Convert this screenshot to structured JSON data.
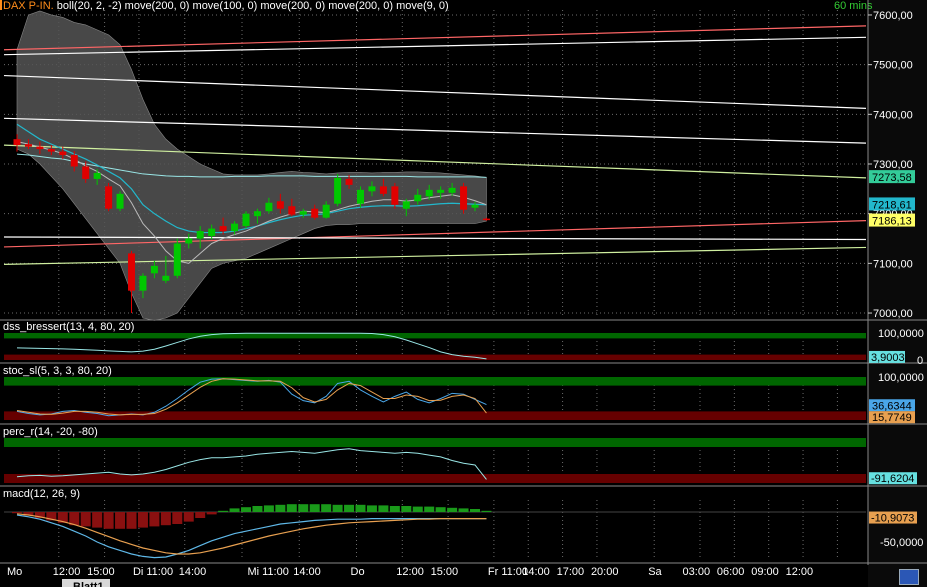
{
  "colors": {
    "background": "#000000",
    "grid": "#6c6c6c",
    "bull": "#00c800",
    "bear": "#e00000",
    "boll_fill": "#555555",
    "ma_cyan": "#22b8cc",
    "ma_lightcyan": "#99e6e6",
    "band_green": "#006600",
    "band_red": "#660000",
    "panel_bg": "#000000",
    "axis_panel": "#000000"
  },
  "header": {
    "symbol": "DAX P-IN.",
    "indicators": "boll(20, 2, -2) move(200, 0) move(100, 0) move(200, 0) move(200, 0) move(9, 0)",
    "interval": "60 mins"
  },
  "tabs": {
    "active": "Blatt1"
  },
  "chart_data": [
    {
      "type": "candlestick",
      "panel": "price",
      "ylim": [
        6990,
        7610
      ],
      "y_ticks": [
        "7600,00",
        "7500,00",
        "7400,00",
        "7300,00",
        "7200,00",
        "7100,00",
        "7000,00"
      ],
      "y_tick_values": [
        7600,
        7500,
        7400,
        7300,
        7200,
        7100,
        7000
      ],
      "price_labels": [
        {
          "text": "7273,58",
          "value": 7273.58,
          "color": "#33cc99"
        },
        {
          "text": "7218,61",
          "value": 7218.61,
          "color": "#22b8cc"
        },
        {
          "text": "7186,13",
          "value": 7186.13,
          "color": "#ffff66"
        }
      ],
      "candles": [
        {
          "o": 7350,
          "h": 7360,
          "l": 7325,
          "c": 7338
        },
        {
          "o": 7340,
          "h": 7350,
          "l": 7330,
          "c": 7335
        },
        {
          "o": 7335,
          "h": 7345,
          "l": 7320,
          "c": 7330
        },
        {
          "o": 7330,
          "h": 7338,
          "l": 7318,
          "c": 7325
        },
        {
          "o": 7325,
          "h": 7335,
          "l": 7310,
          "c": 7318
        },
        {
          "o": 7318,
          "h": 7326,
          "l": 7285,
          "c": 7295
        },
        {
          "o": 7295,
          "h": 7305,
          "l": 7262,
          "c": 7270
        },
        {
          "o": 7270,
          "h": 7290,
          "l": 7258,
          "c": 7282
        },
        {
          "o": 7255,
          "h": 7262,
          "l": 7205,
          "c": 7210
        },
        {
          "o": 7210,
          "h": 7245,
          "l": 7205,
          "c": 7240
        },
        {
          "o": 7120,
          "h": 7125,
          "l": 7000,
          "c": 7045
        },
        {
          "o": 7045,
          "h": 7080,
          "l": 7030,
          "c": 7075
        },
        {
          "o": 7080,
          "h": 7105,
          "l": 7070,
          "c": 7095
        },
        {
          "o": 7065,
          "h": 7115,
          "l": 7060,
          "c": 7075
        },
        {
          "o": 7075,
          "h": 7150,
          "l": 7070,
          "c": 7140
        },
        {
          "o": 7140,
          "h": 7160,
          "l": 7130,
          "c": 7150
        },
        {
          "o": 7150,
          "h": 7175,
          "l": 7130,
          "c": 7165
        },
        {
          "o": 7155,
          "h": 7178,
          "l": 7148,
          "c": 7170
        },
        {
          "o": 7175,
          "h": 7192,
          "l": 7158,
          "c": 7165
        },
        {
          "o": 7165,
          "h": 7185,
          "l": 7158,
          "c": 7180
        },
        {
          "o": 7175,
          "h": 7205,
          "l": 7170,
          "c": 7200
        },
        {
          "o": 7195,
          "h": 7210,
          "l": 7180,
          "c": 7205
        },
        {
          "o": 7205,
          "h": 7232,
          "l": 7200,
          "c": 7222
        },
        {
          "o": 7225,
          "h": 7240,
          "l": 7200,
          "c": 7210
        },
        {
          "o": 7215,
          "h": 7230,
          "l": 7195,
          "c": 7198
        },
        {
          "o": 7198,
          "h": 7210,
          "l": 7192,
          "c": 7205
        },
        {
          "o": 7210,
          "h": 7218,
          "l": 7188,
          "c": 7192
        },
        {
          "o": 7192,
          "h": 7225,
          "l": 7190,
          "c": 7218
        },
        {
          "o": 7220,
          "h": 7280,
          "l": 7215,
          "c": 7272
        },
        {
          "o": 7270,
          "h": 7278,
          "l": 7250,
          "c": 7258
        },
        {
          "o": 7220,
          "h": 7255,
          "l": 7212,
          "c": 7248
        },
        {
          "o": 7245,
          "h": 7265,
          "l": 7235,
          "c": 7255
        },
        {
          "o": 7255,
          "h": 7270,
          "l": 7235,
          "c": 7240
        },
        {
          "o": 7255,
          "h": 7262,
          "l": 7210,
          "c": 7218
        },
        {
          "o": 7210,
          "h": 7230,
          "l": 7195,
          "c": 7225
        },
        {
          "o": 7225,
          "h": 7250,
          "l": 7218,
          "c": 7238
        },
        {
          "o": 7235,
          "h": 7258,
          "l": 7228,
          "c": 7248
        },
        {
          "o": 7242,
          "h": 7255,
          "l": 7230,
          "c": 7248
        },
        {
          "o": 7242,
          "h": 7262,
          "l": 7236,
          "c": 7252
        },
        {
          "o": 7255,
          "h": 7262,
          "l": 7200,
          "c": 7208
        },
        {
          "o": 7212,
          "h": 7224,
          "l": 7205,
          "c": 7218
        },
        {
          "o": 7190,
          "h": 7192,
          "l": 7186,
          "c": 7188
        }
      ],
      "boll_upper": [
        7530,
        7600,
        7608,
        7600,
        7595,
        7585,
        7580,
        7570,
        7560,
        7540,
        7490,
        7430,
        7380,
        7350,
        7330,
        7315,
        7300,
        7290,
        7280,
        7278,
        7278,
        7278,
        7280,
        7283,
        7285,
        7283,
        7282,
        7280,
        7282,
        7283,
        7283,
        7282,
        7283,
        7283,
        7284,
        7284,
        7283,
        7282,
        7280,
        7278,
        7276,
        7273
      ],
      "boll_lower": [
        7330,
        7320,
        7300,
        7275,
        7250,
        7220,
        7190,
        7160,
        7130,
        7100,
        7040,
        6990,
        6985,
        6990,
        7000,
        7030,
        7060,
        7090,
        7100,
        7105,
        7110,
        7120,
        7130,
        7140,
        7150,
        7160,
        7170,
        7176,
        7178,
        7178,
        7180,
        7180,
        7180,
        7180,
        7180,
        7180,
        7180,
        7180,
        7180,
        7180,
        7180,
        7185
      ],
      "ma9": [
        7345,
        7340,
        7334,
        7328,
        7321,
        7310,
        7296,
        7285,
        7270,
        7256,
        7222,
        7180,
        7155,
        7125,
        7105,
        7100,
        7120,
        7140,
        7150,
        7158,
        7165,
        7175,
        7185,
        7193,
        7200,
        7205,
        7204,
        7202,
        7208,
        7215,
        7220,
        7225,
        7228,
        7228,
        7225,
        7228,
        7232,
        7235,
        7238,
        7233,
        7226,
        7218
      ],
      "ma_cyan": [
        7380,
        7365,
        7350,
        7340,
        7330,
        7320,
        7310,
        7298,
        7285,
        7272,
        7250,
        7218,
        7200,
        7185,
        7172,
        7165,
        7162,
        7162,
        7162,
        7165,
        7170,
        7175,
        7182,
        7188,
        7193,
        7197,
        7198,
        7200,
        7205,
        7210,
        7213,
        7215,
        7216,
        7216,
        7215,
        7216,
        7218,
        7220,
        7221,
        7220,
        7219,
        7218
      ],
      "ma_lightcyan": [
        7320,
        7318,
        7315,
        7312,
        7310,
        7305,
        7300,
        7296,
        7292,
        7288,
        7284,
        7280,
        7278,
        7276,
        7275,
        7275,
        7274,
        7274,
        7274,
        7275,
        7275,
        7275,
        7276,
        7276,
        7276,
        7276,
        7275,
        7275,
        7275,
        7275,
        7275,
        7275,
        7275,
        7275,
        7275,
        7274,
        7274,
        7274,
        7274,
        7274,
        7274,
        7273
      ],
      "trend_lines": [
        {
          "color": "#ff6666",
          "y_start": 7530,
          "y_end": 7578
        },
        {
          "color": "#ffffff",
          "y_start": 7520,
          "y_end": 7555
        },
        {
          "color": "#ffffff",
          "y_start": 7478,
          "y_end": 7412
        },
        {
          "color": "#ffffff",
          "y_start": 7392,
          "y_end": 7342
        },
        {
          "color": "#d0f0a0",
          "y_start": 7338,
          "y_end": 7272
        },
        {
          "color": "#ff6666",
          "y_start": 7133,
          "y_end": 7186
        },
        {
          "color": "#ffffff",
          "y_start": 7153,
          "y_end": 7148
        },
        {
          "color": "#d0f0a0",
          "y_start": 7098,
          "y_end": 7132
        }
      ]
    },
    {
      "type": "line",
      "panel": "dss",
      "title": "dss_bressert(13, 4, 80, 20)",
      "ylim": [
        0,
        100
      ],
      "y_ticks": [
        "100,0000",
        "0"
      ],
      "last_label": "3,9003",
      "series": [
        {
          "name": "dss",
          "color": "#99e6e6",
          "values": [
            45,
            44,
            43,
            42,
            41,
            40,
            38,
            36,
            34,
            32,
            30,
            33,
            40,
            52,
            65,
            78,
            88,
            94,
            97,
            98,
            99,
            99,
            99,
            99,
            99,
            99,
            99,
            99,
            99,
            99,
            99,
            98,
            94,
            86,
            74,
            60,
            46,
            30,
            20,
            14,
            10,
            4
          ]
        }
      ]
    },
    {
      "type": "line",
      "panel": "stoc",
      "title": "stoc_sl(5, 3, 3, 80, 20)",
      "ylim": [
        0,
        100
      ],
      "y_ticks": [
        "100,0000"
      ],
      "last_labels": [
        "36,6344",
        "15,7749"
      ],
      "series": [
        {
          "name": "k",
          "color": "#4aa6e8",
          "values": [
            20,
            15,
            12,
            14,
            20,
            22,
            18,
            15,
            10,
            12,
            14,
            12,
            18,
            32,
            50,
            70,
            88,
            95,
            96,
            94,
            92,
            90,
            92,
            88,
            60,
            45,
            40,
            55,
            85,
            90,
            70,
            55,
            42,
            55,
            65,
            48,
            40,
            50,
            62,
            60,
            48,
            36
          ]
        },
        {
          "name": "d",
          "color": "#e8a050",
          "values": [
            22,
            18,
            14,
            13,
            16,
            20,
            20,
            18,
            14,
            12,
            13,
            13,
            15,
            25,
            40,
            58,
            76,
            90,
            96,
            95,
            93,
            91,
            91,
            90,
            75,
            52,
            42,
            48,
            70,
            85,
            80,
            65,
            50,
            50,
            58,
            55,
            45,
            46,
            55,
            58,
            50,
            16
          ]
        }
      ]
    },
    {
      "type": "line",
      "panel": "percr",
      "title": "perc_r(14, -20, -80)",
      "ylim": [
        -100,
        0
      ],
      "last_label": "-91,6204",
      "series": [
        {
          "name": "perc_r",
          "color": "#99e6e6",
          "values": [
            -86,
            -84,
            -83,
            -85,
            -84,
            -82,
            -80,
            -78,
            -76,
            -80,
            -82,
            -80,
            -76,
            -70,
            -62,
            -54,
            -48,
            -44,
            -44,
            -42,
            -40,
            -36,
            -34,
            -32,
            -30,
            -32,
            -34,
            -30,
            -26,
            -24,
            -28,
            -30,
            -32,
            -34,
            -32,
            -34,
            -38,
            -42,
            -50,
            -56,
            -60,
            -92
          ]
        }
      ]
    },
    {
      "type": "bar+line",
      "panel": "macd",
      "title": "macd(12, 26, 9)",
      "ylim": [
        -80,
        20
      ],
      "y_ticks": [
        "-50,0000"
      ],
      "last_label": "-10,9073",
      "hist": [
        -2,
        -6,
        -10,
        -14,
        -18,
        -22,
        -24,
        -26,
        -28,
        -28,
        -28,
        -26,
        -24,
        -22,
        -20,
        -16,
        -10,
        -4,
        2,
        6,
        8,
        10,
        11,
        12,
        13,
        13,
        13,
        13,
        12,
        12,
        12,
        11,
        11,
        10,
        10,
        9,
        9,
        8,
        7,
        6,
        5,
        2
      ],
      "macd": [
        -5,
        -8,
        -12,
        -18,
        -24,
        -32,
        -40,
        -50,
        -58,
        -64,
        -70,
        -74,
        -76,
        -75,
        -70,
        -64,
        -56,
        -48,
        -42,
        -36,
        -32,
        -28,
        -24,
        -20,
        -18,
        -16,
        -14,
        -13,
        -12,
        -12,
        -12,
        -11,
        -11,
        -11,
        -11,
        -11,
        -11,
        -11,
        -11,
        -11,
        -11,
        -11
      ],
      "signal": [
        -3,
        -5,
        -8,
        -12,
        -16,
        -21,
        -27,
        -34,
        -41,
        -48,
        -54,
        -60,
        -64,
        -68,
        -70,
        -70,
        -68,
        -64,
        -60,
        -55,
        -50,
        -45,
        -40,
        -36,
        -32,
        -28,
        -25,
        -22,
        -20,
        -18,
        -17,
        -16,
        -15,
        -14,
        -13,
        -12,
        -12,
        -11,
        -11,
        -11,
        -11,
        -11
      ]
    }
  ],
  "x_axis": {
    "labels": [
      {
        "text": "Mo",
        "bar": 0
      },
      {
        "text": "12:00",
        "bar": 4
      },
      {
        "text": "15:00",
        "bar": 7
      },
      {
        "text": "Di 11:00",
        "bar": 11
      },
      {
        "text": "14:00",
        "bar": 15
      },
      {
        "text": "Mi 11:00",
        "bar": 21
      },
      {
        "text": "14:00",
        "bar": 25
      },
      {
        "text": "Do",
        "bar": 30
      },
      {
        "text": "12:00",
        "bar": 34
      },
      {
        "text": "15:00",
        "bar": 37
      },
      {
        "text": "Fr 11:00",
        "bar": 42
      },
      {
        "text": "14:00",
        "bar": 45
      },
      {
        "text": "17:00",
        "bar": 48
      },
      {
        "text": "20:00",
        "bar": 51
      },
      {
        "text": "Sa",
        "bar": 56
      },
      {
        "text": "03:00",
        "bar": 59
      },
      {
        "text": "06:00",
        "bar": 62
      },
      {
        "text": "09:00",
        "bar": 65
      },
      {
        "text": "12:00",
        "bar": 68
      }
    ]
  }
}
